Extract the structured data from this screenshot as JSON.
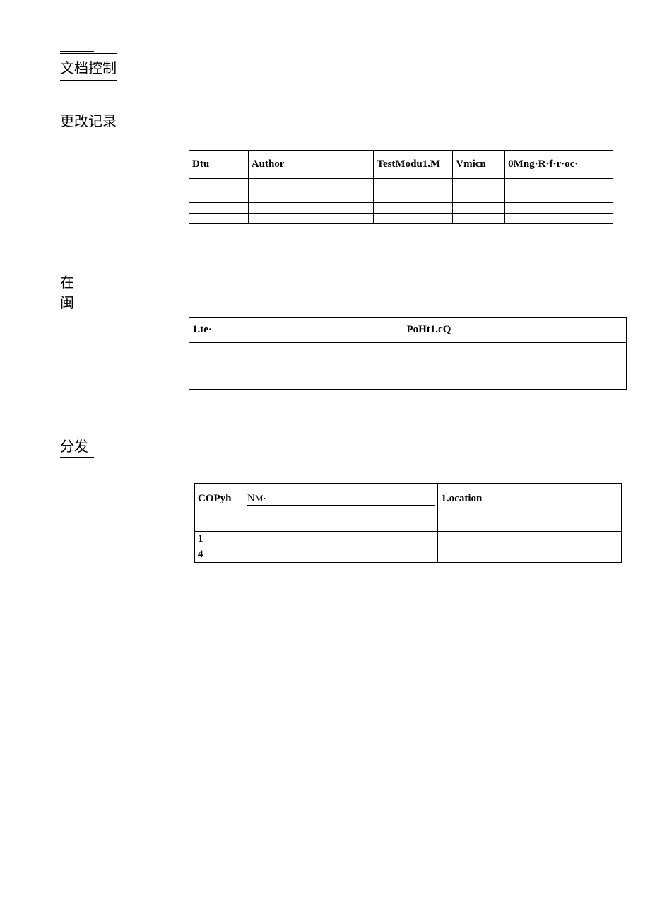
{
  "sections": {
    "doc_control": "文档控制",
    "change_record": "更改记录",
    "reviewers_line1": "在",
    "reviewers_line2": "闽",
    "distribution": "分发"
  },
  "table1": {
    "headers": [
      "Dtu",
      "Author",
      "TestModu1.M",
      "Vmicn",
      "0Mng·R·f·r·oc·"
    ]
  },
  "table2": {
    "headers": [
      "1.te·",
      "PoHt1.cQ"
    ]
  },
  "table3": {
    "headers": [
      "COPyh",
      "NM·",
      "1.ocation"
    ],
    "rows": [
      "1",
      "4"
    ]
  }
}
